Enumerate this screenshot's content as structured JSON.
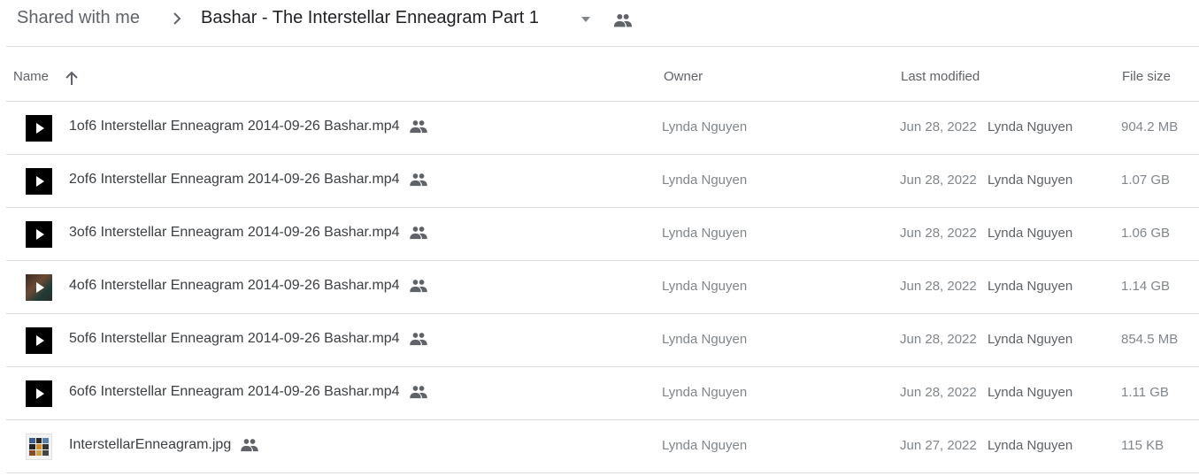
{
  "breadcrumb": {
    "root": "Shared with me",
    "current": "Bashar - The Interstellar Enneagram Part 1",
    "icons": [
      "chevron-right-icon",
      "dropdown-arrow-icon",
      "shared-people-icon"
    ]
  },
  "columns": {
    "name": "Name",
    "owner": "Owner",
    "last_modified": "Last modified",
    "file_size": "File size",
    "sort": "ascending"
  },
  "files": [
    {
      "name": "1of6 Interstellar Enneagram 2014-09-26 Bashar.mp4",
      "type": "video",
      "thumb": "black",
      "owner": "Lynda Nguyen",
      "modified_date": "Jun 28, 2022",
      "modified_by": "Lynda Nguyen",
      "size": "904.2 MB",
      "shared": true
    },
    {
      "name": "2of6 Interstellar Enneagram 2014-09-26 Bashar.mp4",
      "type": "video",
      "thumb": "black",
      "owner": "Lynda Nguyen",
      "modified_date": "Jun 28, 2022",
      "modified_by": "Lynda Nguyen",
      "size": "1.07 GB",
      "shared": true
    },
    {
      "name": "3of6 Interstellar Enneagram 2014-09-26 Bashar.mp4",
      "type": "video",
      "thumb": "black",
      "owner": "Lynda Nguyen",
      "modified_date": "Jun 28, 2022",
      "modified_by": "Lynda Nguyen",
      "size": "1.06 GB",
      "shared": true
    },
    {
      "name": "4of6 Interstellar Enneagram 2014-09-26 Bashar.mp4",
      "type": "video",
      "thumb": "photo",
      "owner": "Lynda Nguyen",
      "modified_date": "Jun 28, 2022",
      "modified_by": "Lynda Nguyen",
      "size": "1.14 GB",
      "shared": true
    },
    {
      "name": "5of6 Interstellar Enneagram 2014-09-26 Bashar.mp4",
      "type": "video",
      "thumb": "black",
      "owner": "Lynda Nguyen",
      "modified_date": "Jun 28, 2022",
      "modified_by": "Lynda Nguyen",
      "size": "854.5 MB",
      "shared": true
    },
    {
      "name": "6of6 Interstellar Enneagram 2014-09-26 Bashar.mp4",
      "type": "video",
      "thumb": "black",
      "owner": "Lynda Nguyen",
      "modified_date": "Jun 28, 2022",
      "modified_by": "Lynda Nguyen",
      "size": "1.11 GB",
      "shared": true
    },
    {
      "name": "InterstellarEnneagram.jpg",
      "type": "image",
      "thumb": "image",
      "owner": "Lynda Nguyen",
      "modified_date": "Jun 27, 2022",
      "modified_by": "Lynda Nguyen",
      "size": "115 KB",
      "shared": true
    }
  ],
  "colors": {
    "text_primary": "#3c4043",
    "text_secondary": "#80868b",
    "divider": "#dadce0",
    "icon": "#5f6368"
  }
}
